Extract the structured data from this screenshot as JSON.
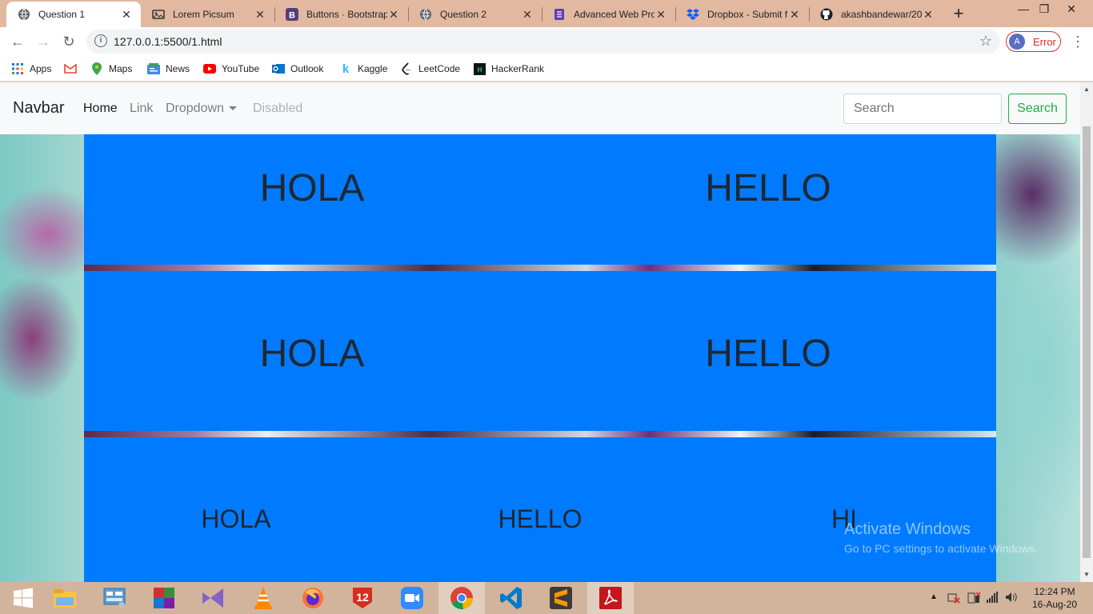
{
  "browser": {
    "tabs": [
      {
        "title": "Question 1",
        "active": true,
        "icon": "globe-icon"
      },
      {
        "title": "Lorem Picsum",
        "active": false,
        "icon": "image-icon"
      },
      {
        "title": "Buttons · Bootstrap",
        "active": false,
        "icon": "bootstrap-icon"
      },
      {
        "title": "Question 2",
        "active": false,
        "icon": "globe-icon"
      },
      {
        "title": "Advanced Web Pro",
        "active": false,
        "icon": "forms-icon"
      },
      {
        "title": "Dropbox - Submit f",
        "active": false,
        "icon": "dropbox-icon"
      },
      {
        "title": "akashbandewar/20",
        "active": false,
        "icon": "github-icon"
      }
    ],
    "url": "127.0.0.1:5500/1.html",
    "profile": {
      "initial": "A",
      "status": "Error"
    },
    "bookmarks": [
      {
        "label": "Apps",
        "icon": "apps-grid-icon"
      },
      {
        "label": "",
        "icon": "gmail-icon"
      },
      {
        "label": "Maps",
        "icon": "maps-pin-icon"
      },
      {
        "label": "News",
        "icon": "news-icon"
      },
      {
        "label": "YouTube",
        "icon": "youtube-icon"
      },
      {
        "label": "Outlook",
        "icon": "outlook-icon"
      },
      {
        "label": "Kaggle",
        "icon": "kaggle-icon"
      },
      {
        "label": "LeetCode",
        "icon": "leetcode-icon"
      },
      {
        "label": "HackerRank",
        "icon": "hackerrank-icon"
      }
    ]
  },
  "page": {
    "navbar": {
      "brand": "Navbar",
      "links": [
        {
          "label": "Home",
          "state": "active"
        },
        {
          "label": "Link",
          "state": "normal"
        },
        {
          "label": "Dropdown",
          "state": "normal",
          "dropdown": true
        },
        {
          "label": "Disabled",
          "state": "disabled"
        }
      ],
      "search_placeholder": "Search",
      "search_button": "Search"
    },
    "rows": [
      {
        "cells": [
          "HOLA",
          "HELLO"
        ]
      },
      {
        "cells": [
          "HOLA",
          "HELLO"
        ]
      },
      {
        "cells": [
          "HOLA",
          "HELLO",
          "HI"
        ]
      }
    ],
    "watermark": {
      "line1": "Activate Windows",
      "line2": "Go to PC settings to activate Windows."
    },
    "colors": {
      "row_bg": "#007bff",
      "search_button": "#28a745"
    }
  },
  "taskbar": {
    "apps": [
      "windows-start-icon",
      "file-explorer-icon",
      "control-panel-icon",
      "winrar-icon",
      "visual-studio-icon",
      "vlc-icon",
      "firefox-icon",
      "dotnet-12-icon",
      "zoom-icon",
      "chrome-icon",
      "vscode-icon",
      "sublime-text-icon",
      "acrobat-reader-icon"
    ],
    "clock": {
      "time": "12:24 PM",
      "date": "16-Aug-20"
    }
  }
}
